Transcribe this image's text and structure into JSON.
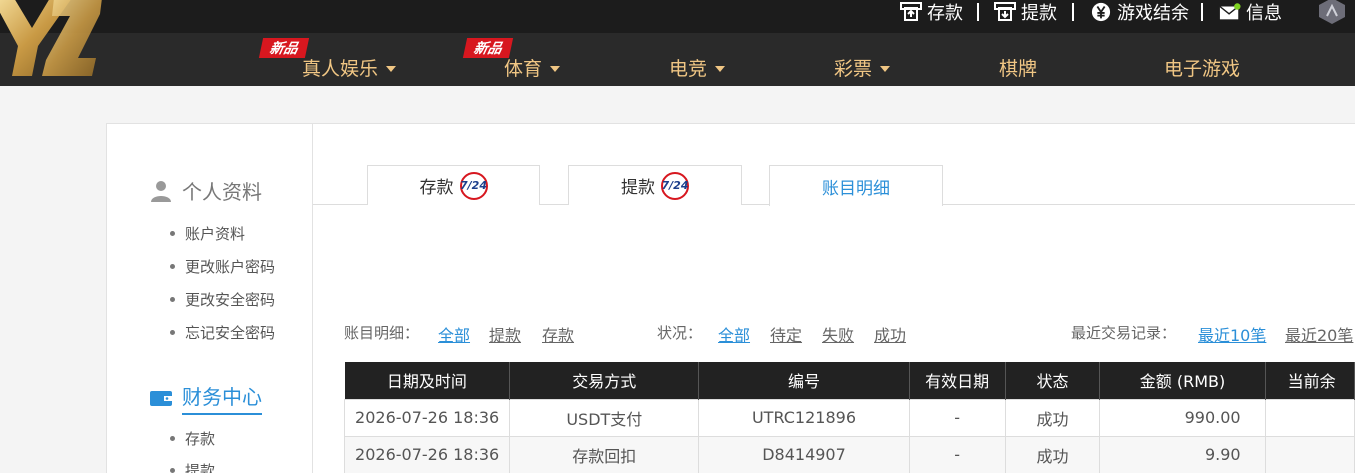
{
  "topbar": {
    "deposit": "存款",
    "withdraw": "提款",
    "settlement": "游戏结余",
    "messages": "信息"
  },
  "nav": {
    "items": [
      {
        "label": "真人娱乐",
        "new": "新品"
      },
      {
        "label": "体育",
        "new": "新品"
      },
      {
        "label": "电竞"
      },
      {
        "label": "彩票"
      },
      {
        "label": "棋牌"
      },
      {
        "label": "电子游戏"
      }
    ]
  },
  "sidebar": {
    "profile_title": "个人资料",
    "profile_items": [
      "账户资料",
      "更改账户密码",
      "更改安全密码",
      "忘记安全密码"
    ],
    "finance_title": "财务中心",
    "finance_items": [
      "存款",
      "提款"
    ]
  },
  "tabs": [
    {
      "label": "存款",
      "badge": "7/24"
    },
    {
      "label": "提款",
      "badge": "7/24"
    },
    {
      "label": "账目明细"
    }
  ],
  "filters": {
    "detail_label": "账目明细：",
    "detail_options": [
      "全部",
      "提款",
      "存款"
    ],
    "status_label": "状况：",
    "status_options": [
      "全部",
      "待定",
      "失败",
      "成功"
    ],
    "recent_label": "最近交易记录：",
    "recent_options": [
      "最近10笔",
      "最近20笔"
    ]
  },
  "table": {
    "headers": [
      "日期及时间",
      "交易方式",
      "编号",
      "有效日期",
      "状态",
      "金额 (RMB)",
      "当前余"
    ],
    "rows": [
      [
        "2026-07-26 18:36",
        "USDT支付",
        "UTRC121896",
        "-",
        "成功",
        "990.00",
        ""
      ],
      [
        "2026-07-26 18:36",
        "存款回扣",
        "D8414907",
        "-",
        "成功",
        "9.90",
        ""
      ]
    ]
  },
  "colors": {
    "accent": "#2b8fd8",
    "nav_gold": "#f0c684",
    "badge_red": "#d7171f",
    "header_dark": "#222222"
  }
}
